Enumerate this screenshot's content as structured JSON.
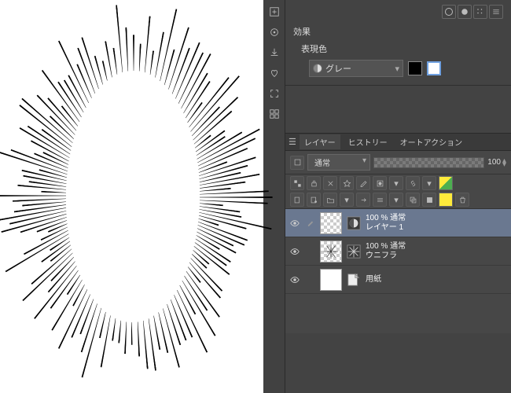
{
  "effect": {
    "title": "効果",
    "expression_label": "表現色",
    "select_value": "グレー"
  },
  "layer_panel": {
    "tabs": {
      "layer": "レイヤー",
      "history": "ヒストリー",
      "action": "オートアクション"
    },
    "blend_mode": "通常",
    "opacity": "100",
    "layers": [
      {
        "opacity_mode": "100 % 通常",
        "name": "レイヤー 1"
      },
      {
        "opacity_mode": "100 % 通常",
        "name": "ウニフラ"
      },
      {
        "opacity_mode": "",
        "name": "用紙"
      }
    ]
  }
}
